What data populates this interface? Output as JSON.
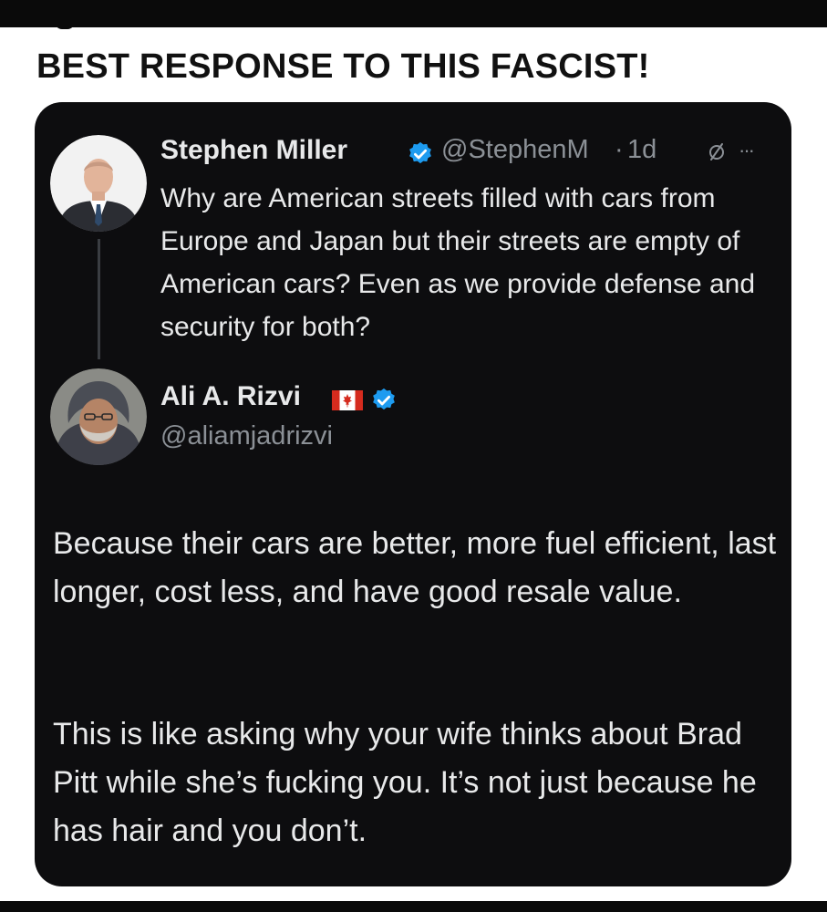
{
  "headline": "BEST RESPONSE TO THIS FASCIST!",
  "tweet": {
    "author_name": "Stephen Miller",
    "handle": "@StephenM",
    "separator": "·",
    "time": "1d",
    "text": "Why are American streets filled with cars from Europe and Japan but their streets are empty of American cars? Even as we provide defense and security for both?",
    "more_label": "···",
    "icons": {
      "verified": "verified-badge-icon",
      "edit": "slashed-circle-icon",
      "more": "more-icon"
    }
  },
  "reply": {
    "author_name": "Ali A. Rizvi",
    "handle": "@aliamjadrizvi",
    "paragraph_1": "Because their cars are better, more fuel efficient, last longer, cost less, and have good resale value.",
    "paragraph_2": "This is like asking why your wife thinks about Brad Pitt while she’s fucking you. It’s not just because he has hair and you don’t.",
    "icons": {
      "flag": "canada-flag-icon",
      "verified": "verified-badge-icon"
    }
  },
  "colors": {
    "background": "#ffffff",
    "card": "#0d0d0f",
    "text_primary": "#e8e9ea",
    "text_secondary": "#8b9096",
    "verified_blue": "#1d9bf0",
    "headline": "#111111"
  }
}
